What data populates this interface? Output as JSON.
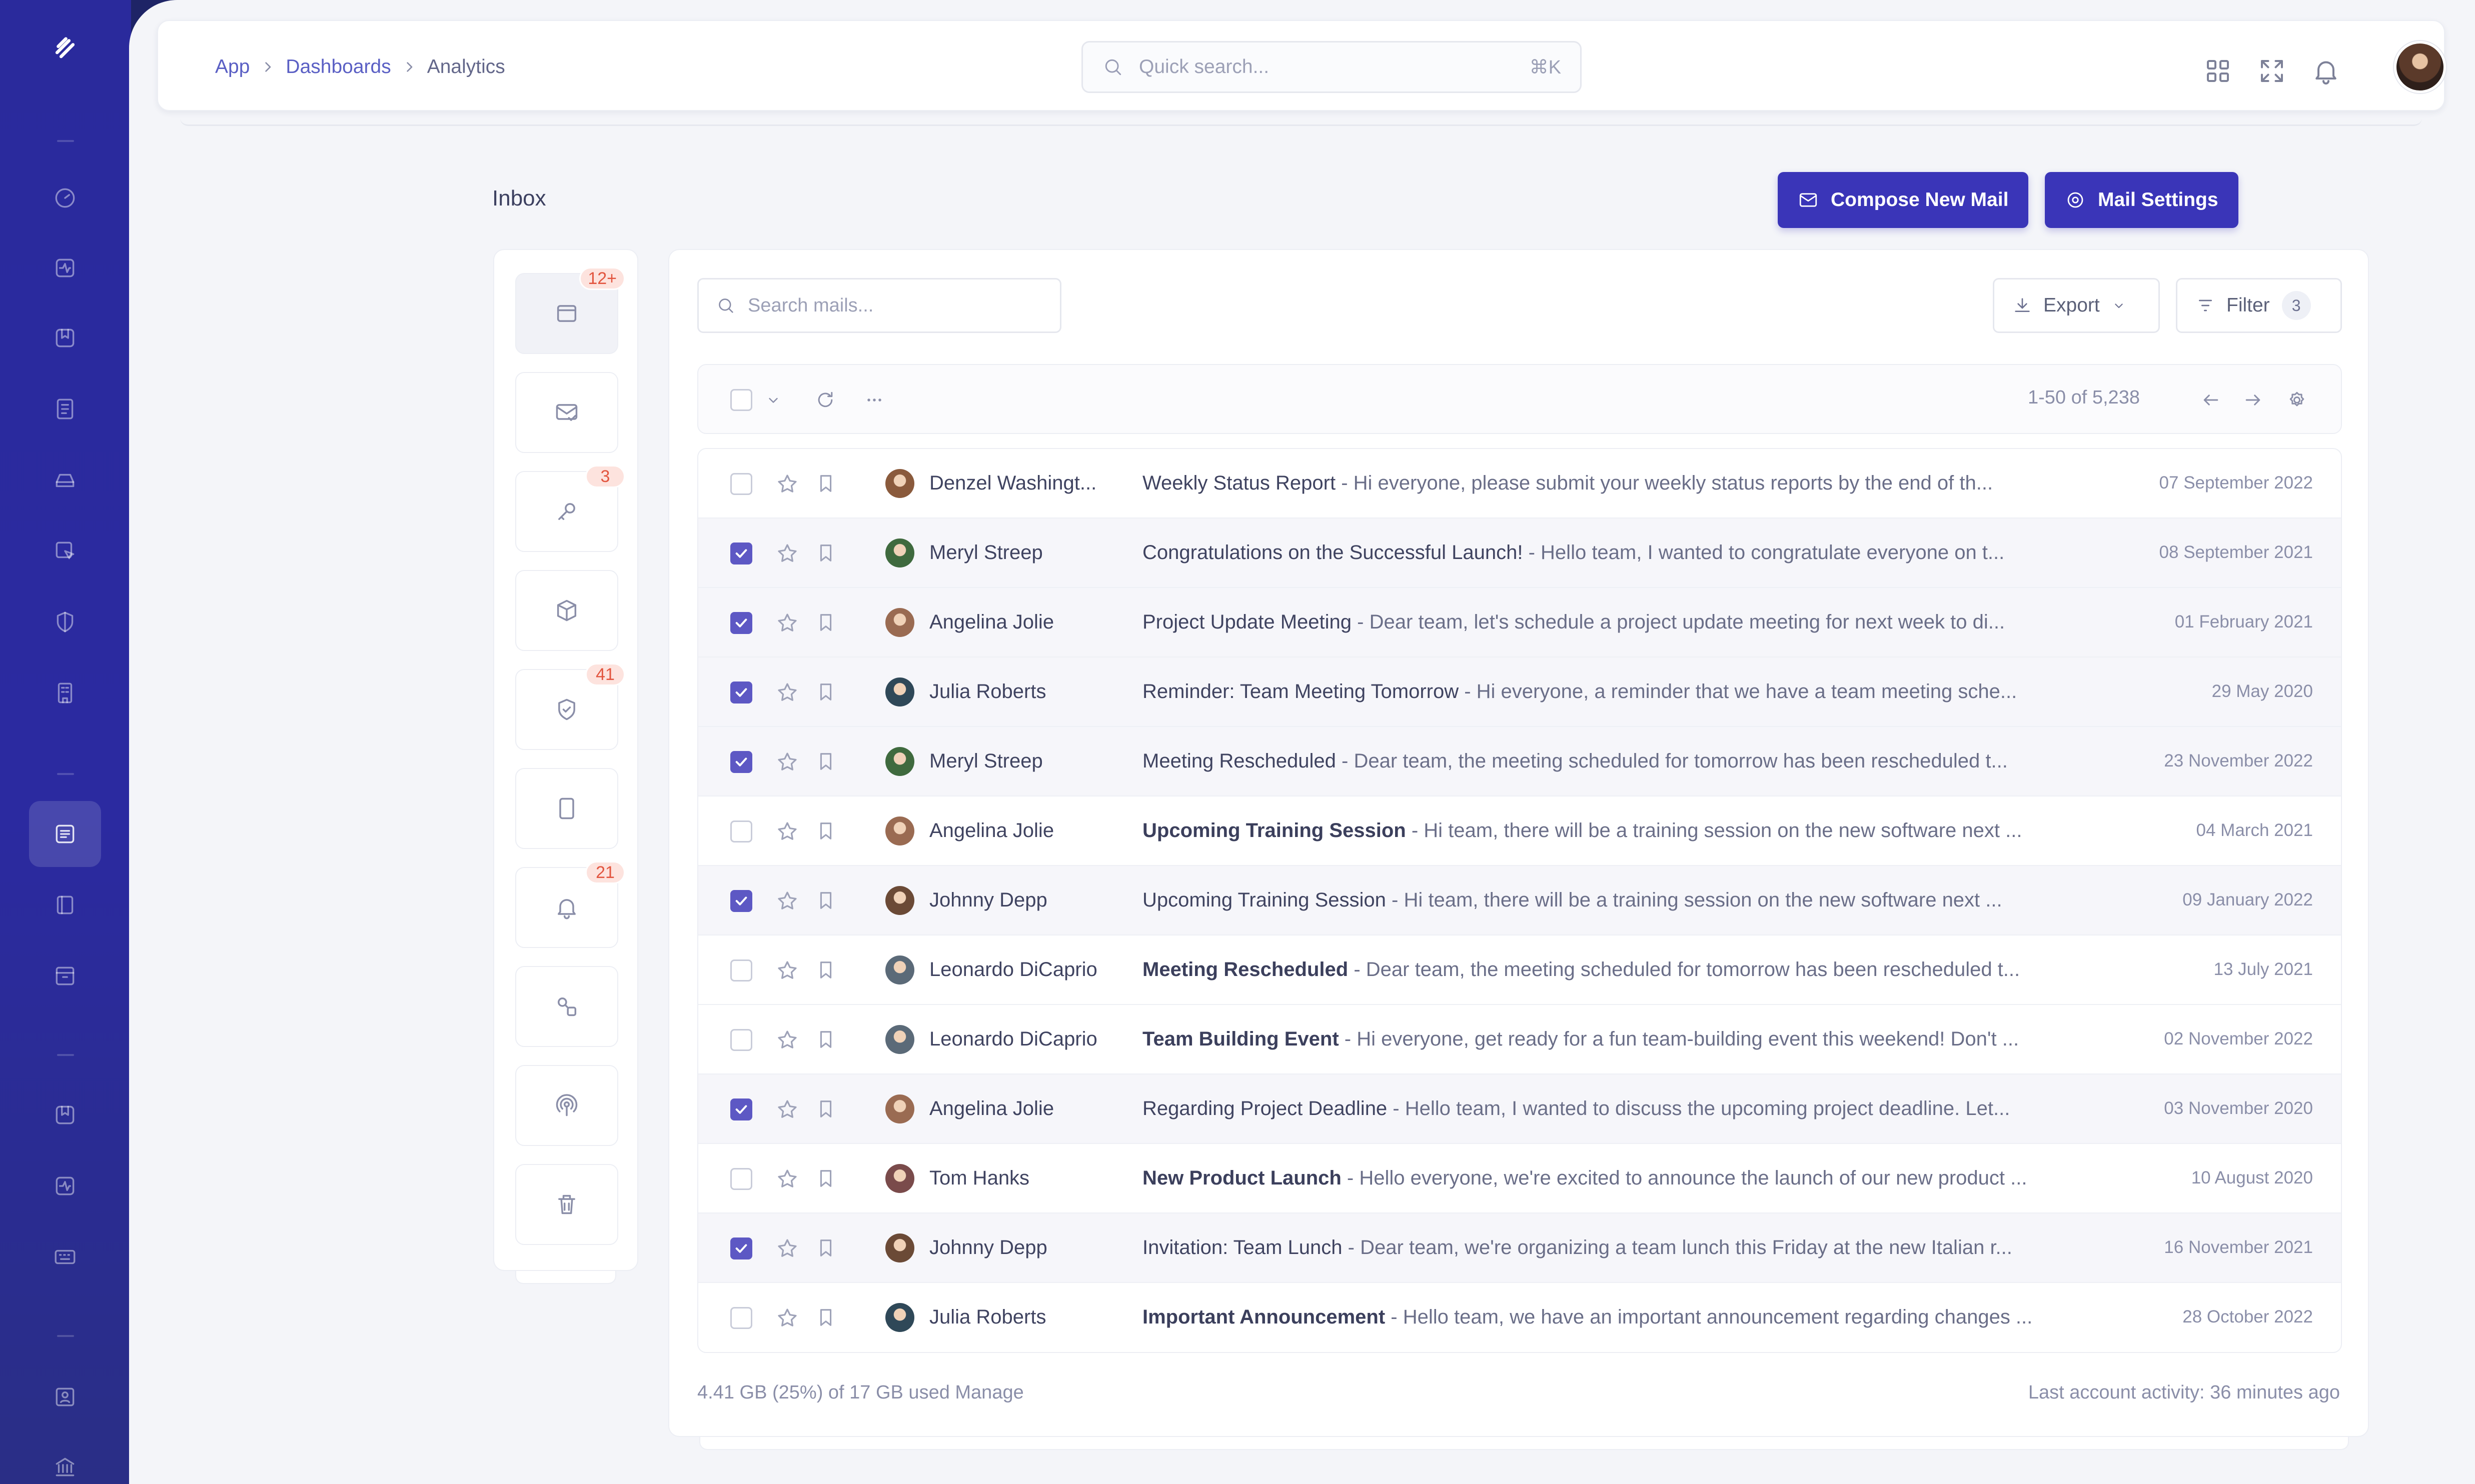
{
  "breadcrumb": [
    "App",
    "Dashboards",
    "Analytics"
  ],
  "quick_search": {
    "placeholder": "Quick search...",
    "shortcut": "⌘K"
  },
  "page_title": "Inbox",
  "actions": {
    "compose": "Compose New Mail",
    "settings": "Mail Settings"
  },
  "folders": [
    {
      "icon": "inbox-icon",
      "badge": "12+",
      "active": true
    },
    {
      "icon": "mail-check-icon",
      "badge": ""
    },
    {
      "icon": "key-icon",
      "badge": "3"
    },
    {
      "icon": "box-icon",
      "badge": ""
    },
    {
      "icon": "shield-check-icon",
      "badge": "41"
    },
    {
      "icon": "tablet-icon",
      "badge": ""
    },
    {
      "icon": "bell-icon",
      "badge": "21"
    },
    {
      "icon": "shapes-icon",
      "badge": ""
    },
    {
      "icon": "broadcast-icon",
      "badge": ""
    },
    {
      "icon": "trash-icon",
      "badge": ""
    }
  ],
  "mail_search": {
    "placeholder": "Search mails..."
  },
  "toolbar": {
    "export_label": "Export",
    "filter_label": "Filter",
    "filter_count": "3",
    "range": "1-50 of 5,238"
  },
  "mails": [
    {
      "name": "Denzel Washingt...",
      "subject": "Weekly Status Report",
      "preview": "Hi everyone, please submit your weekly status reports by the end of th...",
      "date": "07 September 2022",
      "checked": false,
      "unread": false,
      "avatar": "#8a5a3c"
    },
    {
      "name": "Meryl Streep",
      "subject": "Congratulations on the Successful Launch!",
      "preview": "Hello team, I wanted to congratulate everyone on t...",
      "date": "08 September 2021",
      "checked": true,
      "unread": false,
      "avatar": "#3f6a3e"
    },
    {
      "name": "Angelina Jolie",
      "subject": "Project Update Meeting",
      "preview": "Dear team, let's schedule a project update meeting for next week to di...",
      "date": "01 February 2021",
      "checked": true,
      "unread": false,
      "avatar": "#9a6b52"
    },
    {
      "name": "Julia Roberts",
      "subject": "Reminder: Team Meeting Tomorrow",
      "preview": "Hi everyone, a reminder that we have a team meeting sche...",
      "date": "29 May 2020",
      "checked": true,
      "unread": false,
      "avatar": "#2f4858"
    },
    {
      "name": "Meryl Streep",
      "subject": "Meeting Rescheduled",
      "preview": "Dear team, the meeting scheduled for tomorrow has been rescheduled t...",
      "date": "23 November 2022",
      "checked": true,
      "unread": false,
      "avatar": "#3f6a3e"
    },
    {
      "name": "Angelina Jolie",
      "subject": "Upcoming Training Session",
      "preview": "Hi team, there will be a training session on the new software next ...",
      "date": "04 March 2021",
      "checked": false,
      "unread": true,
      "avatar": "#9a6b52"
    },
    {
      "name": "Johnny Depp",
      "subject": "Upcoming Training Session",
      "preview": "Hi team, there will be a training session on the new software next ...",
      "date": "09 January 2022",
      "checked": true,
      "unread": false,
      "avatar": "#6b4a36"
    },
    {
      "name": "Leonardo DiCaprio",
      "subject": "Meeting Rescheduled",
      "preview": "Dear team, the meeting scheduled for tomorrow has been rescheduled t...",
      "date": "13 July 2021",
      "checked": false,
      "unread": true,
      "avatar": "#5b6a78"
    },
    {
      "name": "Leonardo DiCaprio",
      "subject": "Team Building Event",
      "preview": "Hi everyone, get ready for a fun team-building event this weekend! Don't ...",
      "date": "02 November 2022",
      "checked": false,
      "unread": true,
      "avatar": "#5b6a78"
    },
    {
      "name": "Angelina Jolie",
      "subject": "Regarding Project Deadline",
      "preview": "Hello team, I wanted to discuss the upcoming project deadline. Let...",
      "date": "03 November 2020",
      "checked": true,
      "unread": false,
      "avatar": "#9a6b52"
    },
    {
      "name": "Tom Hanks",
      "subject": "New Product Launch",
      "preview": "Hello everyone, we're excited to announce the launch of our new product ...",
      "date": "10 August 2020",
      "checked": false,
      "unread": true,
      "avatar": "#7a4b4b"
    },
    {
      "name": "Johnny Depp",
      "subject": "Invitation: Team Lunch",
      "preview": "Dear team, we're organizing a team lunch this Friday at the new Italian r...",
      "date": "16 November 2021",
      "checked": true,
      "unread": false,
      "avatar": "#6b4a36"
    },
    {
      "name": "Julia Roberts",
      "subject": "Important Announcement",
      "preview": "Hello team, we have an important announcement regarding changes ...",
      "date": "28 October 2022",
      "checked": false,
      "unread": true,
      "avatar": "#2f4858"
    }
  ],
  "footer": {
    "storage": "4.41 GB (25%) of 17 GB used Manage",
    "activity": "Last account activity: 36 minutes ago"
  },
  "colors": {
    "primary": "#3a35b8",
    "rail": "#2b2aa0",
    "badge_bg": "#fde3de",
    "badge_text": "#e2553f"
  }
}
